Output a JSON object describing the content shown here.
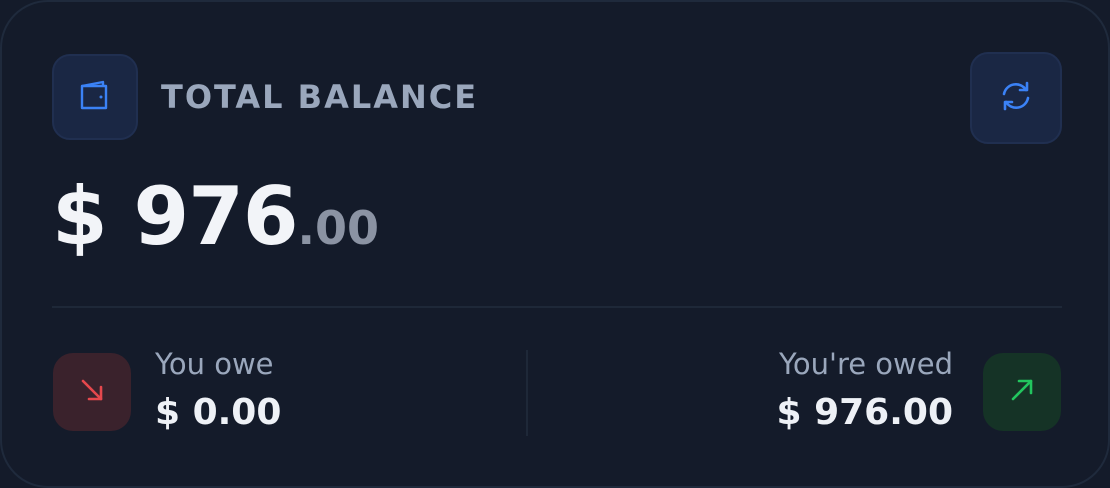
{
  "header": {
    "title": "TOTAL BALANCE",
    "wallet_icon": "wallet-icon",
    "refresh_icon": "refresh-icon"
  },
  "balance": {
    "currency": "$",
    "whole": "976",
    "cents": ".00"
  },
  "you_owe": {
    "label": "You owe",
    "amount": "$ 0.00",
    "icon": "arrow-down-right-icon",
    "accent": "#e5484d"
  },
  "youre_owed": {
    "label": "You're owed",
    "amount": "$ 976.00",
    "icon": "arrow-up-right-icon",
    "accent": "#22c55e"
  },
  "colors": {
    "background": "#141b2a",
    "icon_accent": "#3b82f6",
    "muted_text": "#9aa7bc"
  }
}
